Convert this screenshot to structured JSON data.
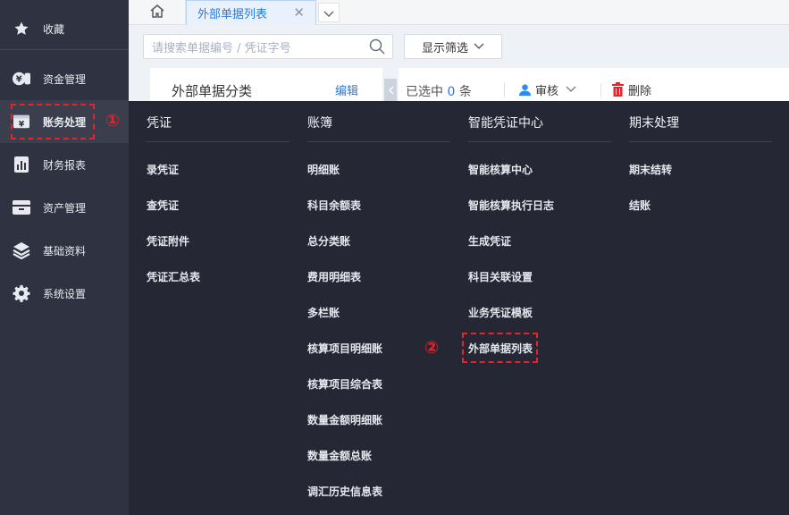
{
  "sidebar": {
    "items": [
      {
        "label": "收藏",
        "icon": "star-icon"
      },
      {
        "label": "资金管理",
        "icon": "money-icon"
      },
      {
        "label": "账务处理",
        "icon": "ledger-icon"
      },
      {
        "label": "财务报表",
        "icon": "report-icon"
      },
      {
        "label": "资产管理",
        "icon": "asset-icon"
      },
      {
        "label": "基础资料",
        "icon": "layers-icon"
      },
      {
        "label": "系统设置",
        "icon": "gear-icon"
      }
    ],
    "active_index": 2
  },
  "tabs": {
    "home_icon": "home-icon",
    "active_tab": "外部单据列表",
    "close_icon": "close-icon"
  },
  "search": {
    "placeholder": "请搜索单据编号 / 凭证字号"
  },
  "filter_button": "显示筛选",
  "panel": {
    "title": "外部单据分类",
    "edit": "编辑"
  },
  "toolbar": {
    "selected_prefix": "已选中",
    "selected_count": "0",
    "selected_suffix": "条",
    "audit": "审核",
    "delete": "删除"
  },
  "menu": {
    "columns": [
      {
        "title": "凭证",
        "items": [
          "录凭证",
          "查凭证",
          "凭证附件",
          "凭证汇总表"
        ]
      },
      {
        "title": "账簿",
        "items": [
          "明细账",
          "科目余额表",
          "总分类账",
          "费用明细表",
          "多栏账",
          "核算项目明细账",
          "核算项目综合表",
          "数量金额明细账",
          "数量金额总账",
          "调汇历史信息表"
        ]
      },
      {
        "title": "智能凭证中心",
        "items": [
          "智能核算中心",
          "智能核算执行日志",
          "生成凭证",
          "科目关联设置",
          "业务凭证模板",
          "外部单据列表"
        ]
      },
      {
        "title": "期末处理",
        "items": [
          "期末结转",
          "结账"
        ]
      }
    ]
  },
  "annotations": {
    "step1": "①",
    "step2": "②"
  },
  "colors": {
    "accent": "#2d8cf0",
    "annotation": "#e8242a",
    "menu_bg": "#252834",
    "sidebar_bg": "#2f3240"
  }
}
